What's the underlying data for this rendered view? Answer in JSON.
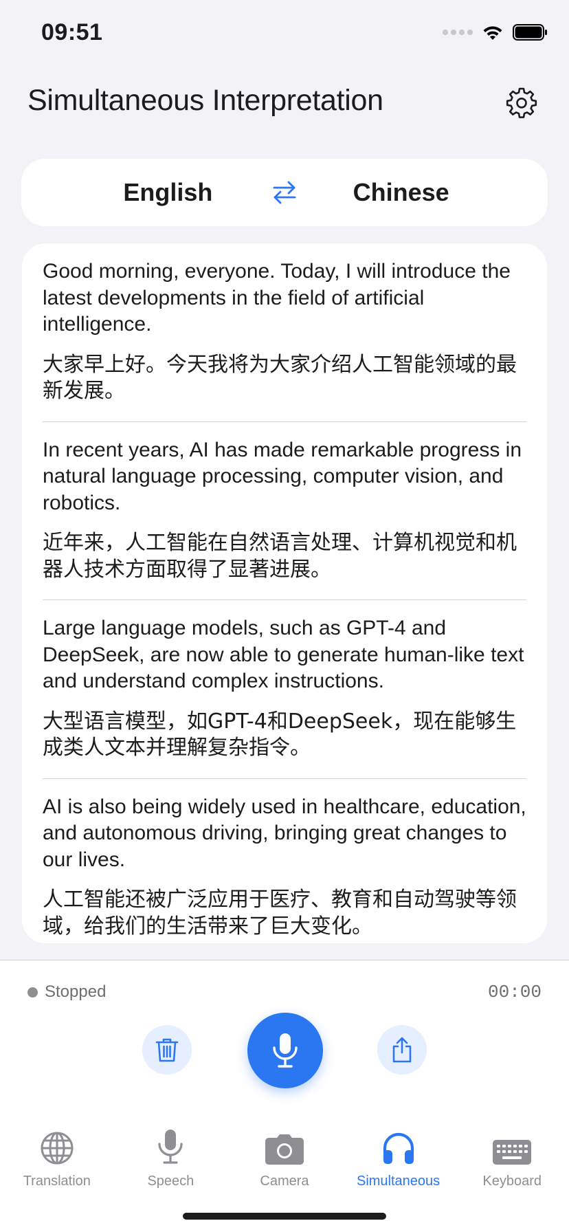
{
  "status_bar": {
    "time": "09:51"
  },
  "header": {
    "title": "Simultaneous Interpretation",
    "settings_icon": "gear-icon"
  },
  "languages": {
    "source": "English",
    "target": "Chinese",
    "swap_icon": "swap-arrows-icon"
  },
  "transcript": [
    {
      "source": "Good morning, everyone. Today, I will introduce the latest developments in the field of artificial intelligence.",
      "target": "大家早上好。今天我将为大家介绍人工智能领域的最新发展。"
    },
    {
      "source": "In recent years, AI has made remarkable progress in natural language processing, computer vision, and robotics.",
      "target": "近年来，人工智能在自然语言处理、计算机视觉和机器人技术方面取得了显著进展。"
    },
    {
      "source": "Large language models, such as GPT-4 and DeepSeek, are now able to generate human-like text and understand complex instructions.",
      "target": "大型语言模型，如GPT-4和DeepSeek，现在能够生成类人文本并理解复杂指令。"
    },
    {
      "source": "AI is also being widely used in healthcare, education, and autonomous driving, bringing great changes to our lives.",
      "target": "人工智能还被广泛应用于医疗、教育和自动驾驶等领域，给我们的生活带来了巨大变化。"
    }
  ],
  "recording": {
    "status": "Stopped",
    "timer": "00:00"
  },
  "controls": {
    "delete_icon": "trash-icon",
    "mic_icon": "microphone-icon",
    "share_icon": "share-icon"
  },
  "tabs": [
    {
      "label": "Translation",
      "icon": "globe-icon",
      "active": false
    },
    {
      "label": "Speech",
      "icon": "microphone-icon",
      "active": false
    },
    {
      "label": "Camera",
      "icon": "camera-icon",
      "active": false
    },
    {
      "label": "Simultaneous",
      "icon": "headphones-icon",
      "active": true
    },
    {
      "label": "Keyboard",
      "icon": "keyboard-icon",
      "active": false
    }
  ],
  "colors": {
    "accent": "#2a77f1",
    "background": "#f2f2f7",
    "inactive": "#8e8e93"
  }
}
